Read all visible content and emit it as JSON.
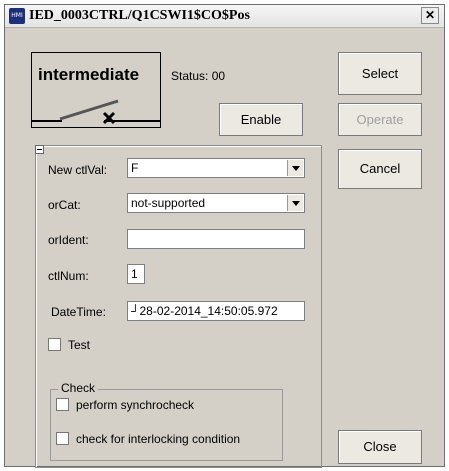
{
  "window": {
    "title": "IED_0003CTRL/Q1CSWI1$CO$Pos",
    "icon_label": "HMI",
    "close_glyph": "✕"
  },
  "status": {
    "state": "intermediate",
    "label": "Status: 00"
  },
  "buttons": {
    "enable": "Enable",
    "select": "Select",
    "operate": "Operate",
    "cancel": "Cancel",
    "close": "Close"
  },
  "form": {
    "ctlval_label": "New ctlVal:",
    "ctlval_value": "F",
    "orcat_label": "orCat:",
    "orcat_value": "not-supported",
    "orident_label": "orIdent:",
    "orident_value": "",
    "ctlnum_label": "ctlNum:",
    "ctlnum_value": "1",
    "datetime_label": "DateTime:",
    "datetime_value": "┘28-02-2014_14:50:05.972",
    "test_label": "Test"
  },
  "check_group": {
    "title": "Check",
    "synchro_label": "perform synchrocheck",
    "interlock_label": "check for interlocking condition"
  },
  "colors": {
    "window_bg": "#d4d0c8",
    "disabled_text": "#a0a0a0"
  }
}
